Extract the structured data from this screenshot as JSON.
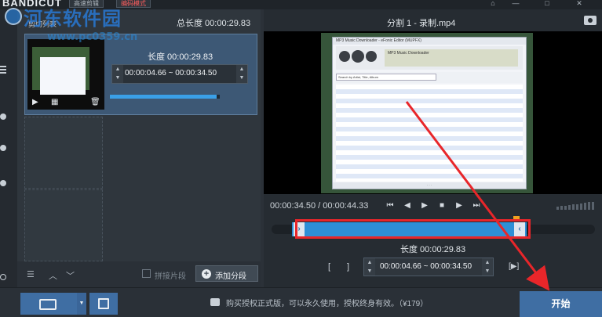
{
  "app": {
    "logo": "BANDICUT",
    "top_tabs": [
      "高速剪辑",
      "编码模式"
    ]
  },
  "watermark": {
    "title": "河东软件园",
    "url": "www.pc0359.cn"
  },
  "left_panel": {
    "header_label": "剪切列表",
    "total_length": "总长度 00:00:29.83",
    "segment": {
      "length": "长度 00:00:29.83",
      "range": "00:00:04.66 ~ 00:00:34.50",
      "progress": 0.97
    },
    "footer": {
      "merge_label": "拼接片段",
      "add_segment": "添加分段"
    }
  },
  "right_panel": {
    "video_title": "分割 1 - 录制.mp4",
    "video_content": {
      "window_title": "MP3 Music Downloader - eFonic Editor (MUPFX)",
      "search_placeholder": "Search by Artist, Title, Album",
      "player_info": "MP3 Music Downloader"
    },
    "time_display": "00:00:34.50 / 00:00:44.33",
    "selection_length": "长度 00:00:29.83",
    "range": "00:00:04.66 ~ 00:00:34.50"
  },
  "bottom": {
    "buy_message": "购买授权正式版，可以永久使用，授权终身有效。（¥179）",
    "start_label": "开始"
  },
  "colors": {
    "accent": "#3f6ea3",
    "highlight": "#e8262a",
    "timeline": "#2e8fd6"
  }
}
